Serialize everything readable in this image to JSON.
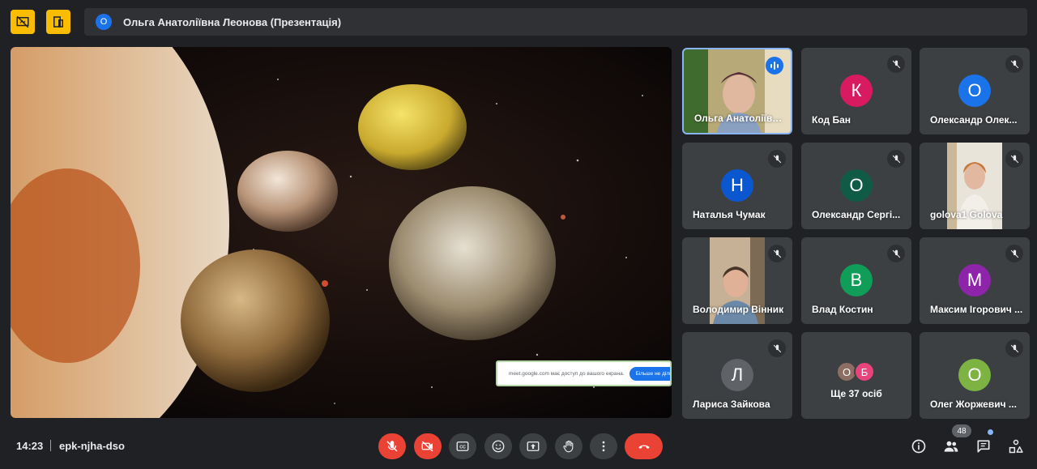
{
  "header": {
    "presenter_initial": "О",
    "presenter_title": "Ольга Анатоліївна Леонова (Презентація)",
    "accent": "#fbbc04",
    "icons": [
      "hide-presentation-icon",
      "pip-icon"
    ]
  },
  "share_notice": {
    "text": "meet.google.com має доступ до вашого екрана.",
    "button": "Більше не ділитися"
  },
  "participants": [
    {
      "name": "Ольга Анатоліївн...",
      "type": "video",
      "speaking": true
    },
    {
      "name": "Код Бан",
      "initial": "К",
      "color": "#d81b60",
      "muted": true
    },
    {
      "name": "Олександр Олек...",
      "initial": "О",
      "color": "#1a73e8",
      "muted": true
    },
    {
      "name": "Наталья Чумак",
      "initial": "Н",
      "color": "#0b57d0",
      "muted": true
    },
    {
      "name": "Олександр Сергі...",
      "initial": "О",
      "color": "#0f5b45",
      "muted": true
    },
    {
      "name": "golova1 Golova",
      "type": "video",
      "muted": true
    },
    {
      "name": "Володимир Вінник",
      "type": "video",
      "muted": true
    },
    {
      "name": "Влад Костин",
      "initial": "В",
      "color": "#0f9d58",
      "muted": true
    },
    {
      "name": "Максим Ігорович ...",
      "initial": "М",
      "color": "#8e24aa",
      "muted": true
    },
    {
      "name": "Лариса Зайкова",
      "initial": "Л",
      "color": "#5f6368",
      "muted": true
    },
    {
      "name": "Олег Жоржевич ...",
      "initial": "О",
      "color": "#7cb342",
      "muted": true
    }
  ],
  "more": {
    "avatars": [
      {
        "initial": "О",
        "color": "#8d6e63"
      },
      {
        "initial": "Б",
        "color": "#e8437a"
      }
    ],
    "label": "Ще 37 осіб"
  },
  "footer": {
    "time": "14:23",
    "meeting_code": "epk-njha-dso",
    "participant_count": "48",
    "controls": [
      "mic-off-icon",
      "camera-off-icon",
      "captions-icon",
      "emoji-icon",
      "present-icon",
      "raise-hand-icon",
      "more-options-icon",
      "end-call-icon"
    ],
    "side": [
      "info-icon",
      "people-icon",
      "chat-icon",
      "activities-icon"
    ]
  }
}
